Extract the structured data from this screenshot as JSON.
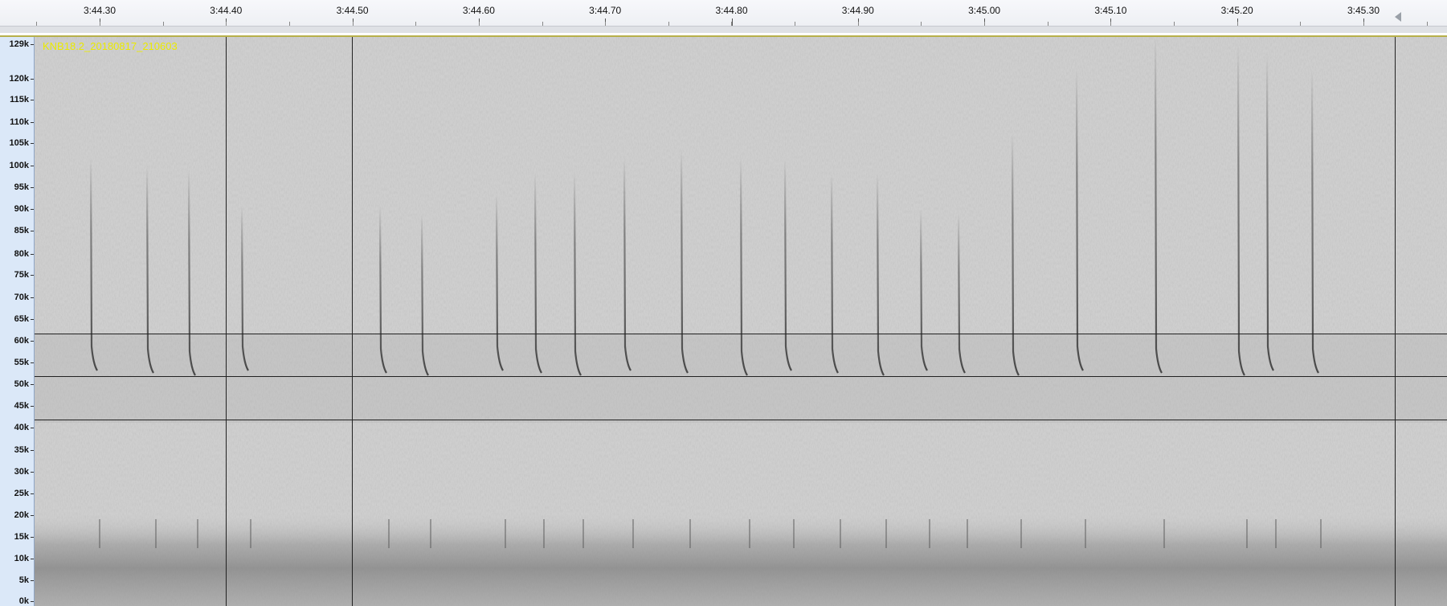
{
  "ruler": {
    "time_labels": [
      "3:44.30",
      "3:44.40",
      "3:44.50",
      "3:44.60",
      "3:44.70",
      "3:44.80",
      "3:44.90",
      "3:45.00",
      "3:45.10",
      "3:45.20",
      "3:45.30"
    ]
  },
  "axis": {
    "unit": "k",
    "labels": [
      "129k",
      "120k",
      "115k",
      "110k",
      "105k",
      "100k",
      "95k",
      "90k",
      "85k",
      "80k",
      "75k",
      "70k",
      "65k",
      "60k",
      "55k",
      "50k",
      "45k",
      "40k",
      "35k",
      "30k",
      "25k",
      "20k",
      "15k",
      "10k",
      "5k",
      "0k"
    ]
  },
  "track": {
    "name": "KNB18.2_20180817_210603"
  },
  "colors": {
    "spectrogram_bg": "#cfcfcf",
    "track_name": "#eaea00",
    "axis_bg": "#dbe8f8",
    "guide_line": "#222222"
  }
}
